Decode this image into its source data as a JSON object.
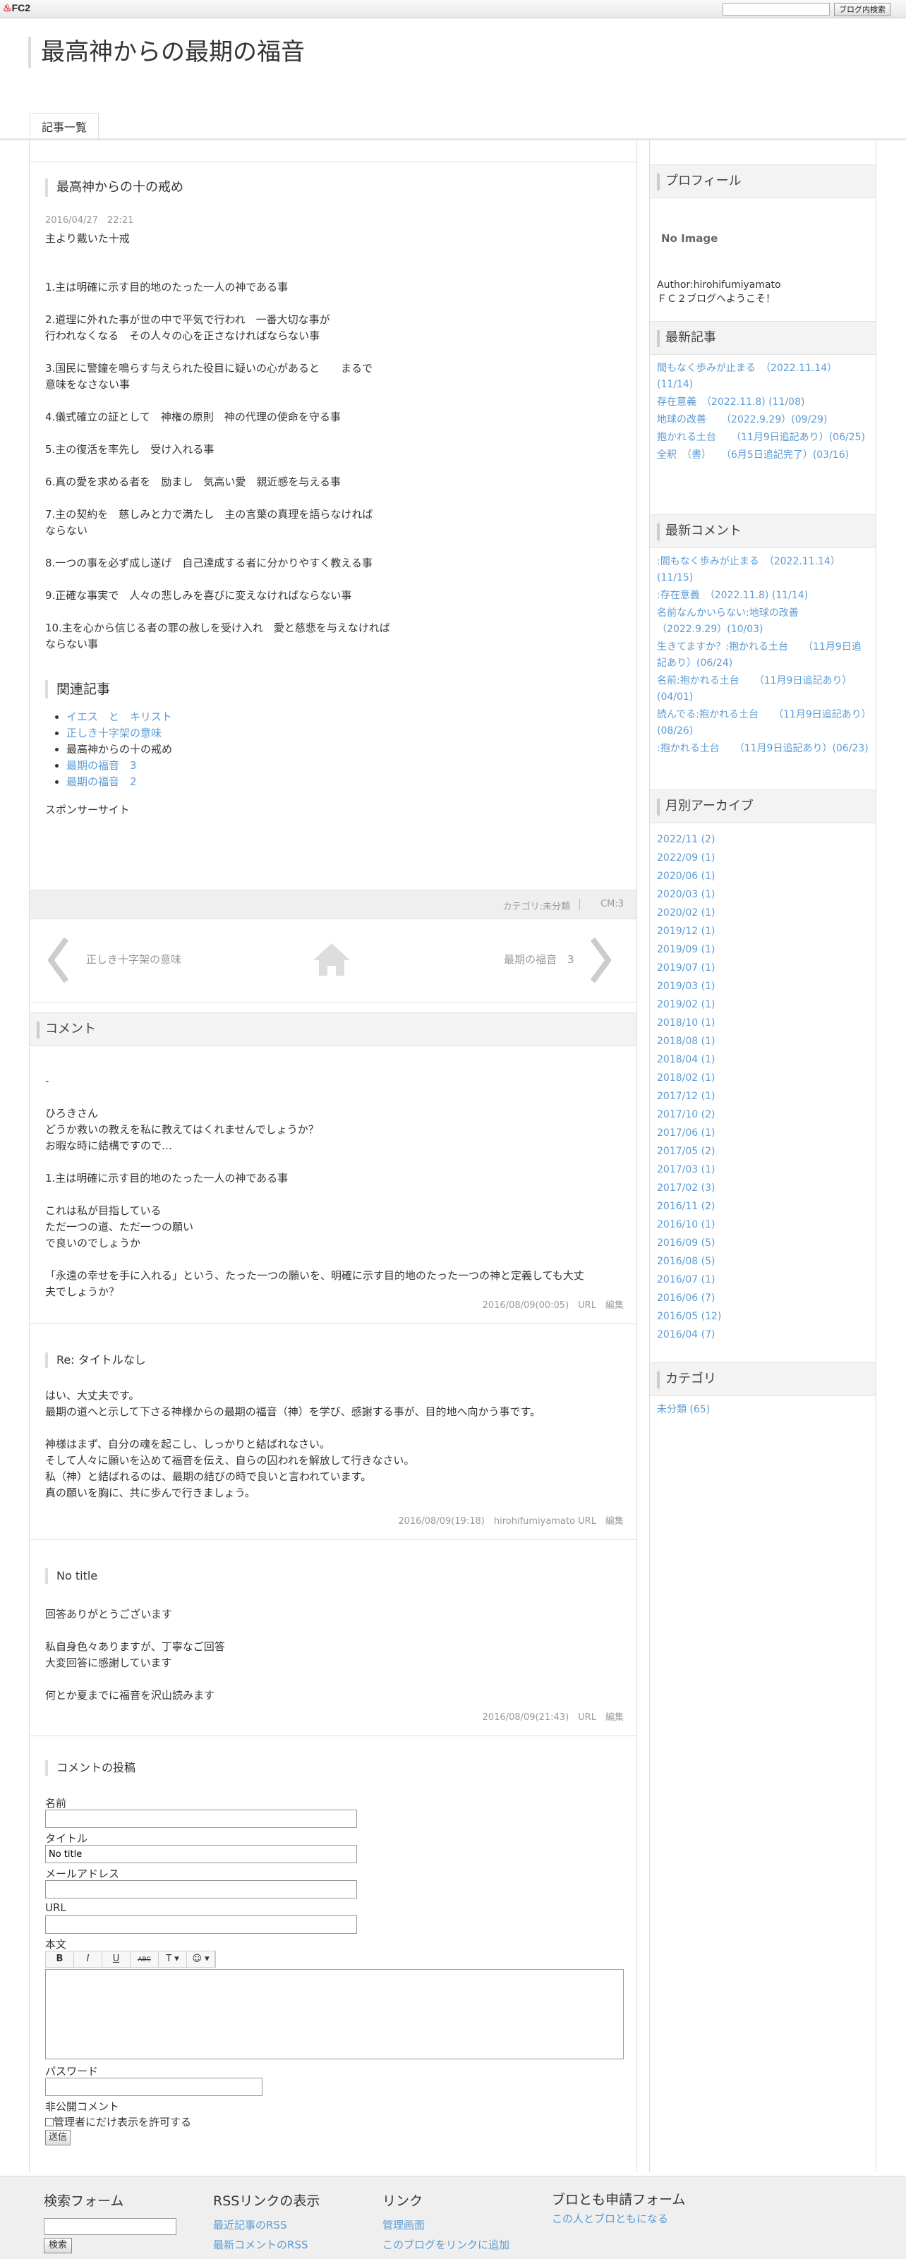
{
  "fc2bar": {
    "logo": "FC2",
    "search_placeholder": "",
    "search_button": "ブログ内検索"
  },
  "site": {
    "title": "最高神からの最期の福音",
    "nav_tab": "記事一覧"
  },
  "entry": {
    "title": "最高神からの十の戒め",
    "date": "2016/04/27　22:21",
    "body": "主より戴いた十戒\n\n\n1.主は明確に示す目的地のたった一人の神である事\n\n2.道理に外れた事が世の中で平気で行われ　一番大切な事が\n行われなくなる　その人々の心を正さなければならない事\n\n3.国民に警鐘を鳴らす与えられた役目に疑いの心があると　　まるで\n意味をなさない事\n\n4.儀式確立の証として　神権の原則　神の代理の使命を守る事\n\n5.主の復活を率先し　受け入れる事\n\n6.真の愛を求める者を　励まし　気高い愛　親近感を与える事\n\n7.主の契約を　慈しみと力で満たし　主の言葉の真理を語らなければ\nならない\n\n8.一つの事を必ず成し遂げ　自己達成する者に分かりやすく教える事\n\n9.正確な事実で　人々の悲しみを喜びに変えなければならない事\n\n10.主を心から信じる者の罪の赦しを受け入れ　愛と慈悲を与えなければ\nならない事",
    "related_title": "関連記事",
    "related": [
      {
        "label": "イエス　と　キリスト",
        "link": true
      },
      {
        "label": "正しき十字架の意味",
        "link": true
      },
      {
        "label": "最高神からの十の戒め",
        "link": false
      },
      {
        "label": "最期の福音　3",
        "link": true
      },
      {
        "label": "最期の福音　2",
        "link": true
      }
    ],
    "sponsor": "スポンサーサイト",
    "footer_category": "カテゴリ:未分類",
    "footer_cm": "CM:3",
    "prev_label": "正しき十字架の意味",
    "next_label": "最期の福音　3"
  },
  "comments_heading": "コメント",
  "comments": [
    {
      "title": "",
      "body": "-\n\nひろきさん\nどうか救いの教えを私に教えてはくれませんでしょうか？\nお暇な時に結構ですので…\n\n1.主は明確に示す目的地のたった一人の神である事\n\nこれは私が目指している\nただ一つの道、ただ一つの願い\nで良いのでしょうか\n\n「永遠の幸せを手に入れる」という、たった一つの願いを、明確に示す目的地のたった一つの神と定義しても大丈\n夫でしょうか？",
      "meta": "2016/08/09(00:05)",
      "author": "",
      "url": "URL",
      "edit": "編集"
    },
    {
      "title": "Re: タイトルなし",
      "body": "はい、大丈夫です。\n最期の道へと示して下さる神様からの最期の福音（神）を学び、感謝する事が、目的地へ向かう事です。\n\n神様はまず、自分の魂を起こし、しっかりと結ばれなさい。\nそして人々に願いを込めて福音を伝え、自らの囚われを解放して行きなさい。\n私（神）と結ばれるのは、最期の結びの時で良いと言われています。\n真の願いを胸に、共に歩んで行きましょう。",
      "meta": "2016/08/09(19:18)",
      "author": "hirohifumiyamato",
      "url": "URL",
      "edit": "編集"
    },
    {
      "title": "No title",
      "body": "回答ありがとうございます\n\n私自身色々ありますが、丁寧なご回答\n大変回答に感謝しています\n\n何とか夏までに福音を沢山読みます",
      "meta": "2016/08/09(21:43)",
      "author": "",
      "url": "URL",
      "edit": "編集"
    }
  ],
  "post_form": {
    "heading": "コメントの投稿",
    "name_label": "名前",
    "name_value": "",
    "title_label": "タイトル",
    "title_value": "No title",
    "email_label": "メールアドレス",
    "email_value": "",
    "url_label": "URL",
    "url_value": "",
    "body_label": "本文",
    "password_label": "パスワード",
    "private_label": "非公開コメント",
    "private_checkbox": "管理者にだけ表示を許可する",
    "submit": "送信",
    "toolbar": [
      "B",
      "I",
      "U",
      "ABC",
      "T ▾",
      "☺ ▾"
    ]
  },
  "sidebar": {
    "profile": {
      "heading": "プロフィール",
      "no_image": "No Image",
      "author": "Author:hirohifumiyamato",
      "greeting": "ＦＣ２ブログへようこそ！"
    },
    "recent_entries": {
      "heading": "最新記事",
      "items": [
        "間もなく歩みが止まる　（2022.11.14）(11/14)",
        "存在意義　（2022.11.8) (11/08)",
        "地球の改善　　（2022.9.29）(09/29)",
        "抱かれる土台　　（11月9日追記あり）(06/25)",
        "全釈　（書）　　（6月5日追記完了）(03/16)"
      ]
    },
    "recent_comments": {
      "heading": "最新コメント",
      "items": [
        ":間もなく歩みが止まる　（2022.11.14）(11/15)",
        ":存在意義　（2022.11.8) (11/14)",
        "名前なんかいらない:地球の改善　　（2022.9.29）(10/03)",
        "生きてますか？:抱かれる土台　　（11月9日追記あり）(06/24)",
        "名前:抱かれる土台　　（11月9日追記あり）(04/01)",
        "読んでる:抱かれる土台　　（11月9日追記あり）(08/26)",
        ":抱かれる土台　　（11月9日追記あり）(06/23)"
      ]
    },
    "archives": {
      "heading": "月別アーカイブ",
      "items": [
        "2022/11 (2)",
        "2022/09 (1)",
        "2020/06 (1)",
        "2020/03 (1)",
        "2020/02 (1)",
        "2019/12 (1)",
        "2019/09 (1)",
        "2019/07 (1)",
        "2019/03 (1)",
        "2019/02 (1)",
        "2018/10 (1)",
        "2018/08 (1)",
        "2018/04 (1)",
        "2018/02 (1)",
        "2017/12 (1)",
        "2017/10 (2)",
        "2017/06 (1)",
        "2017/05 (2)",
        "2017/03 (1)",
        "2017/02 (3)",
        "2016/11 (2)",
        "2016/10 (1)",
        "2016/09 (5)",
        "2016/08 (5)",
        "2016/07 (1)",
        "2016/06 (7)",
        "2016/05 (12)",
        "2016/04 (7)"
      ]
    },
    "categories": {
      "heading": "カテゴリ",
      "items": [
        "未分類 (65)"
      ]
    }
  },
  "footer": {
    "search": {
      "heading": "検索フォーム",
      "button": "検索"
    },
    "rss": {
      "heading": "RSSリンクの表示",
      "items": [
        "最近記事のRSS",
        "最新コメントのRSS"
      ]
    },
    "links": {
      "heading": "リンク",
      "items": [
        "管理画面",
        "このブログをリンクに追加"
      ]
    },
    "friend": {
      "heading": "ブロとも申請フォーム",
      "items": [
        "この人とブロともになる"
      ]
    }
  }
}
